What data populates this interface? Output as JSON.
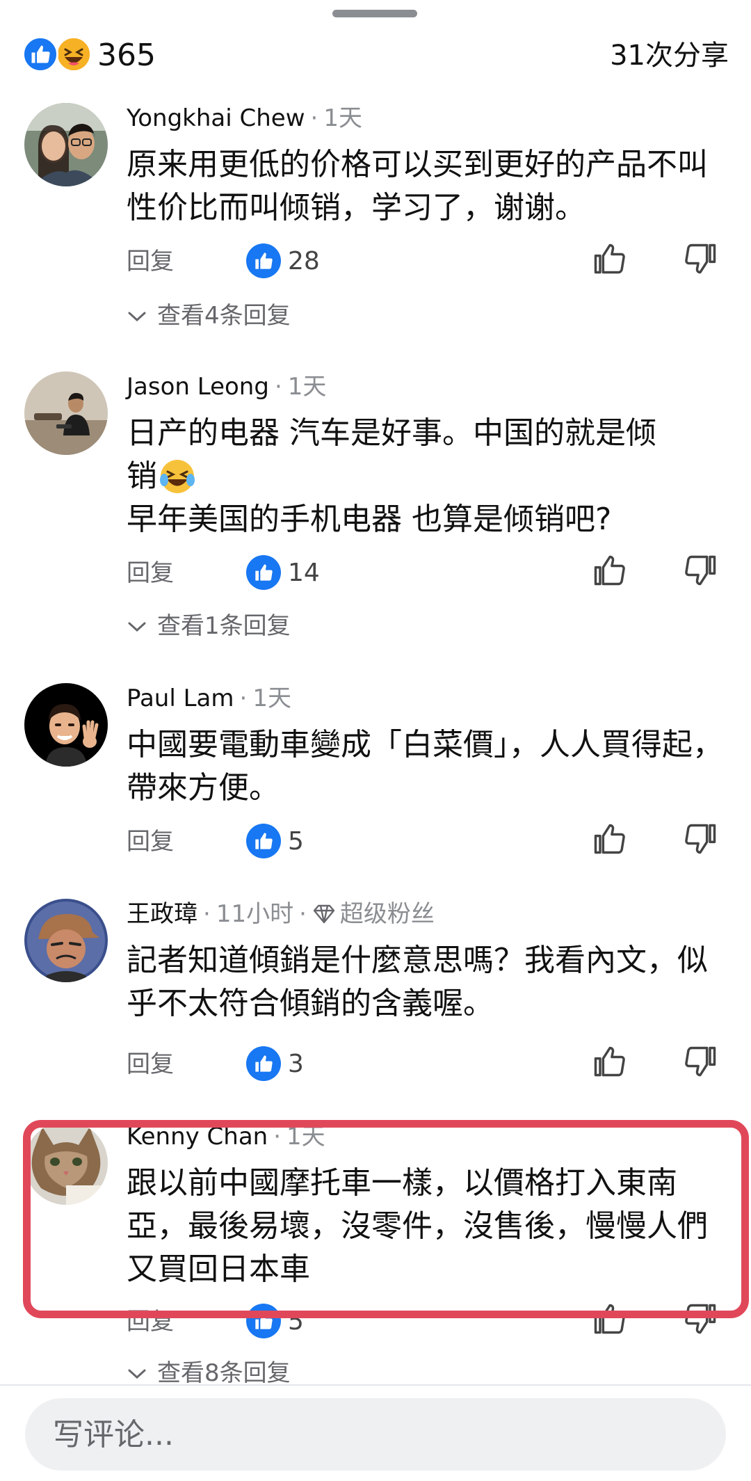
{
  "summary": {
    "reaction_count": "365",
    "shares": "31次分享"
  },
  "comments": [
    {
      "name": "Yongkhai Chew",
      "time": "1天",
      "text": "原来用更低的价格可以买到更好的产品不叫性价比而叫倾销，学习了，谢谢。",
      "reply_label": "回复",
      "likes": "28",
      "view_replies": "查看4条回复"
    },
    {
      "name": "Jason Leong",
      "time": "1天",
      "text_line1": "日产的电器 汽车是好事。中国的就是倾",
      "text_line2": "销",
      "text_line3": "早年美国的手机电器 也算是倾销吧?",
      "reply_label": "回复",
      "likes": "14",
      "view_replies": "查看1条回复"
    },
    {
      "name": "Paul Lam",
      "time": "1天",
      "text": "中國要電動車變成「白菜價」，人人買得起，帶來方便。",
      "reply_label": "回复",
      "likes": "5"
    },
    {
      "name": "王政璋",
      "time": "11小时",
      "badge": "超级粉丝",
      "text": "記者知道傾銷是什麼意思嗎？我看內文，似乎不太符合傾銷的含義喔。",
      "reply_label": "回复",
      "likes": "3"
    },
    {
      "name": "Kenny Chan",
      "time": "1天",
      "text": "跟以前中國摩托車一樣，以價格打入東南亞，最後易壞，沒零件，沒售後，慢慢人們又買回日本車",
      "reply_label": "回复",
      "likes": "5",
      "view_replies": "查看8条回复"
    }
  ],
  "composer": {
    "placeholder": "写评论..."
  },
  "colors": {
    "like_blue": "#1877f2",
    "highlight_red": "#e0485a",
    "secondary_text": "#65676b"
  }
}
